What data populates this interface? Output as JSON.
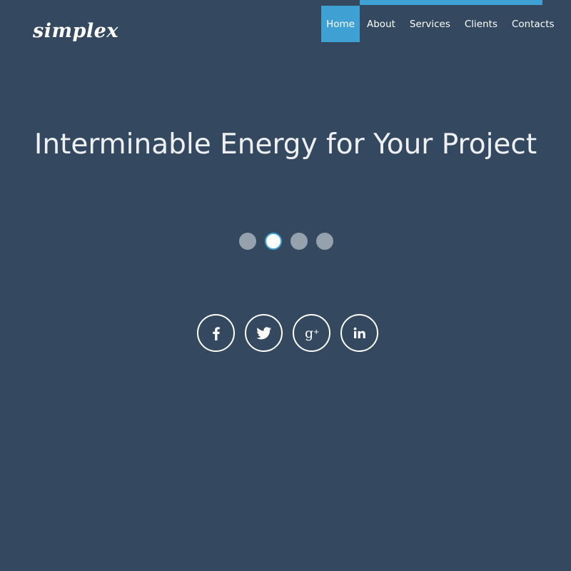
{
  "brand": {
    "logo_text": "simplex"
  },
  "nav": {
    "items": [
      {
        "label": "Home",
        "active": true
      },
      {
        "label": "About",
        "active": false
      },
      {
        "label": "Services",
        "active": false
      },
      {
        "label": "Clients",
        "active": false
      },
      {
        "label": "Contacts",
        "active": false
      }
    ]
  },
  "hero": {
    "title": "Interminable Energy for Your Project"
  },
  "slider": {
    "slide_count": 4,
    "active_index": 1
  },
  "social": {
    "icons": [
      "facebook-icon",
      "twitter-icon",
      "google-plus-icon",
      "linkedin-icon"
    ]
  },
  "colors": {
    "background": "#34495f",
    "accent": "#3fa1d3",
    "inactive_dot": "#95a1ad",
    "text": "#ffffff"
  }
}
